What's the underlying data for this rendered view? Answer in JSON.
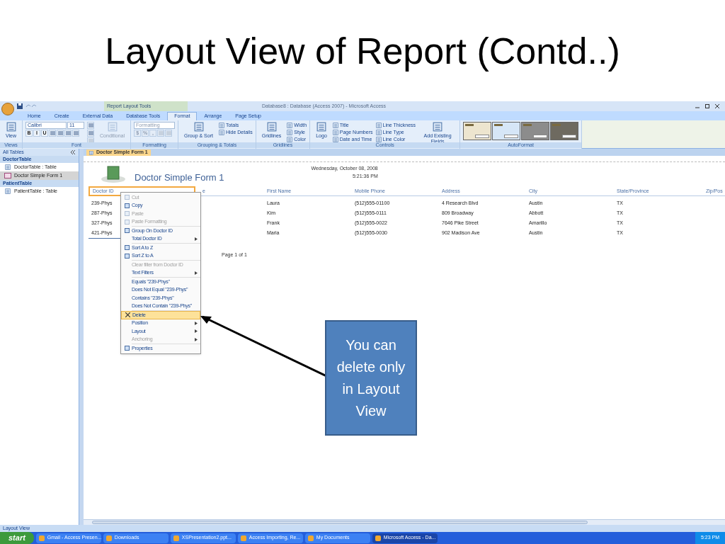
{
  "slide_title": "Layout View of Report (Contd..)",
  "window": {
    "title": "Database8 : Database (Access 2007) - Microsoft Access",
    "contextual_label": "Report Layout Tools"
  },
  "ribbon_tabs": [
    {
      "label": "Home",
      "selected": false
    },
    {
      "label": "Create",
      "selected": false
    },
    {
      "label": "External Data",
      "selected": false
    },
    {
      "label": "Database Tools",
      "selected": false
    },
    {
      "label": "Format",
      "selected": true
    },
    {
      "label": "Arrange",
      "selected": false
    },
    {
      "label": "Page Setup",
      "selected": false
    }
  ],
  "ribbon_groups": [
    {
      "label": "Views",
      "columns": [
        [
          [
            {
              "kind": "large",
              "label": "View",
              "disabled": false
            }
          ]
        ]
      ]
    },
    {
      "label": "Font",
      "columns": [
        [
          [
            {
              "kind": "field",
              "label": "Calibri",
              "disabled": false
            },
            {
              "kind": "field",
              "label": "11",
              "disabled": false
            }
          ],
          [
            {
              "kind": "text-button",
              "label": "B",
              "disabled": false
            },
            {
              "kind": "text-button",
              "label": "I",
              "disabled": false
            },
            {
              "kind": "text-button",
              "label": "U",
              "disabled": false
            },
            {
              "kind": "icon-button",
              "disabled": false
            },
            {
              "kind": "icon-button",
              "disabled": false
            },
            {
              "kind": "icon-button",
              "disabled": false
            },
            {
              "kind": "icon-button",
              "disabled": false
            }
          ]
        ],
        [
          [
            {
              "kind": "icon-button",
              "disabled": false
            }
          ],
          [
            {
              "kind": "icon-button",
              "disabled": false
            }
          ],
          [
            {
              "kind": "icon-button",
              "disabled": true
            }
          ]
        ],
        [
          [
            {
              "kind": "large",
              "label": "Conditional",
              "disabled": true
            }
          ]
        ]
      ]
    },
    {
      "label": "Formatting",
      "columns": [
        [
          [
            {
              "kind": "field",
              "label": "Formatting",
              "disabled": true
            }
          ],
          [
            {
              "kind": "text-button",
              "label": "$",
              "disabled": true
            },
            {
              "kind": "text-button",
              "label": "%",
              "disabled": true
            },
            {
              "kind": "text-button",
              "label": ",",
              "disabled": true
            },
            {
              "kind": "icon-button",
              "disabled": true
            },
            {
              "kind": "icon-button",
              "disabled": true
            }
          ]
        ]
      ]
    },
    {
      "label": "Grouping & Totals",
      "columns": [
        [
          [
            {
              "kind": "large",
              "label": "Group & Sort",
              "disabled": false
            }
          ]
        ],
        [
          [
            {
              "kind": "small",
              "label": "Totals",
              "disabled": false
            }
          ],
          [
            {
              "kind": "small",
              "label": "Hide Details",
              "disabled": false
            }
          ]
        ]
      ]
    },
    {
      "label": "Gridlines",
      "columns": [
        [
          [
            {
              "kind": "large",
              "label": "Gridlines",
              "disabled": false
            }
          ]
        ],
        [
          [
            {
              "kind": "small",
              "label": "Width",
              "disabled": false
            }
          ],
          [
            {
              "kind": "small",
              "label": "Style",
              "disabled": false
            }
          ],
          [
            {
              "kind": "small",
              "label": "Color",
              "disabled": false
            }
          ]
        ]
      ]
    },
    {
      "label": "Controls",
      "columns": [
        [
          [
            {
              "kind": "large",
              "label": "Logo",
              "disabled": false
            }
          ]
        ],
        [
          [
            {
              "kind": "small",
              "label": "Title",
              "disabled": false
            }
          ],
          [
            {
              "kind": "small",
              "label": "Page Numbers",
              "disabled": false
            }
          ],
          [
            {
              "kind": "small",
              "label": "Date and Time",
              "disabled": false
            }
          ]
        ],
        [
          [
            {
              "kind": "small",
              "label": "Line Thickness",
              "disabled": false
            }
          ],
          [
            {
              "kind": "small",
              "label": "Line Type",
              "disabled": false
            }
          ],
          [
            {
              "kind": "small",
              "label": "Line Color",
              "disabled": false
            }
          ]
        ],
        [
          [
            {
              "kind": "large",
              "label": "Add Existing Fields",
              "disabled": false
            }
          ]
        ]
      ]
    },
    {
      "label": "AutoFormat",
      "columns": [
        [
          [
            {
              "kind": "swatch",
              "color": "#ede5cf"
            },
            {
              "kind": "swatch",
              "color": "#d6e6f7"
            },
            {
              "kind": "swatch",
              "color": "#8c8c8c"
            },
            {
              "kind": "swatch",
              "color": "#6e6a60"
            }
          ]
        ]
      ]
    }
  ],
  "nav_pane": {
    "title": "All Tables",
    "groups": [
      {
        "label": "DoctorTable",
        "items": [
          {
            "label": "DoctorTable : Table",
            "kind": "table",
            "selected": false
          },
          {
            "label": "Doctor Simple Form 1",
            "kind": "form",
            "selected": true
          }
        ]
      },
      {
        "label": "PatientTable",
        "items": [
          {
            "label": "PatientTable : Table",
            "kind": "table",
            "selected": false
          }
        ]
      }
    ]
  },
  "document_tab": "Doctor Simple Form 1",
  "report": {
    "title": "Doctor Simple Form 1",
    "date": "Wednesday, October 08, 2008",
    "time": "5:21:36 PM",
    "page": "Page 1 of 1",
    "columns": [
      {
        "label": "Doctor ID",
        "selected": true
      },
      {
        "label": "e",
        "selected": false
      },
      {
        "label": "First Name",
        "selected": false
      },
      {
        "label": "Mobile Phone",
        "selected": false
      },
      {
        "label": "Address",
        "selected": false
      },
      {
        "label": "City",
        "selected": false
      },
      {
        "label": "State/Province",
        "selected": false
      },
      {
        "label": "Zip/Pos",
        "selected": false
      }
    ],
    "rows": [
      [
        "239-Phys",
        "",
        "Laura",
        "(512)555-01100",
        "4 Research Blvd",
        "Austin",
        "TX",
        ""
      ],
      [
        "287-Phys",
        "",
        "Kim",
        "(512)555-0111",
        "809 Broadway",
        "Abbott",
        "TX",
        ""
      ],
      [
        "327-Phys",
        "",
        "Frank",
        "(512)555-0022",
        "7646 Pike Street",
        "Amarillo",
        "TX",
        ""
      ],
      [
        "421-Phys",
        "",
        "Maria",
        "(512)555-0030",
        "902 Madison Ave",
        "Austin",
        "TX",
        ""
      ]
    ]
  },
  "context_menu": [
    {
      "label": "Cut",
      "disabled": true,
      "selected": false,
      "submenu": false,
      "icon": true
    },
    {
      "label": "Copy",
      "disabled": false,
      "selected": false,
      "submenu": false,
      "icon": true
    },
    {
      "label": "Paste",
      "disabled": true,
      "selected": false,
      "submenu": false,
      "icon": true
    },
    {
      "label": "Paste Formatting",
      "disabled": true,
      "selected": false,
      "submenu": false,
      "icon": true,
      "separator_after": true
    },
    {
      "label": "Group On Doctor ID",
      "disabled": false,
      "selected": false,
      "submenu": false,
      "icon": true
    },
    {
      "label": "Total Doctor ID",
      "disabled": false,
      "selected": false,
      "submenu": true,
      "icon": false,
      "separator_after": true
    },
    {
      "label": "Sort A to Z",
      "disabled": false,
      "selected": false,
      "submenu": false,
      "icon": true
    },
    {
      "label": "Sort Z to A",
      "disabled": false,
      "selected": false,
      "submenu": false,
      "icon": true,
      "separator_after": true
    },
    {
      "label": "Clear filter from Doctor ID",
      "disabled": true,
      "selected": false,
      "submenu": false,
      "icon": false
    },
    {
      "label": "Text Filters",
      "disabled": false,
      "selected": false,
      "submenu": true,
      "icon": false,
      "separator_after": true
    },
    {
      "label": "Equals \"239-Phys\"",
      "disabled": false,
      "selected": false,
      "submenu": false,
      "icon": false
    },
    {
      "label": "Does Not Equal \"239-Phys\"",
      "disabled": false,
      "selected": false,
      "submenu": false,
      "icon": false
    },
    {
      "label": "Contains \"239-Phys\"",
      "disabled": false,
      "selected": false,
      "submenu": false,
      "icon": false
    },
    {
      "label": "Does Not Contain \"239-Phys\"",
      "disabled": false,
      "selected": false,
      "submenu": false,
      "icon": false,
      "separator_after": true
    },
    {
      "label": "Delete",
      "disabled": false,
      "selected": true,
      "submenu": false,
      "icon": true
    },
    {
      "label": "Position",
      "disabled": false,
      "selected": false,
      "submenu": true,
      "icon": false
    },
    {
      "label": "Layout",
      "disabled": false,
      "selected": false,
      "submenu": true,
      "icon": false
    },
    {
      "label": "Anchoring",
      "disabled": true,
      "selected": false,
      "submenu": true,
      "icon": false,
      "separator_after": true
    },
    {
      "label": "Properties",
      "disabled": false,
      "selected": false,
      "submenu": false,
      "icon": true
    }
  ],
  "status_bar": "Layout View",
  "taskbar": {
    "start": "start",
    "items": [
      {
        "label": "Gmail - Access Presen...",
        "selected": false
      },
      {
        "label": "Downloads",
        "selected": false
      },
      {
        "label": "XSPresentation2.ppt...",
        "selected": false
      },
      {
        "label": "Access Importing, Re...",
        "selected": false
      },
      {
        "label": "My Documents",
        "selected": false
      },
      {
        "label": "Microsoft Access - Da...",
        "selected": true
      }
    ],
    "clock": "5:23 PM"
  },
  "callout": "You can delete only in Layout View"
}
